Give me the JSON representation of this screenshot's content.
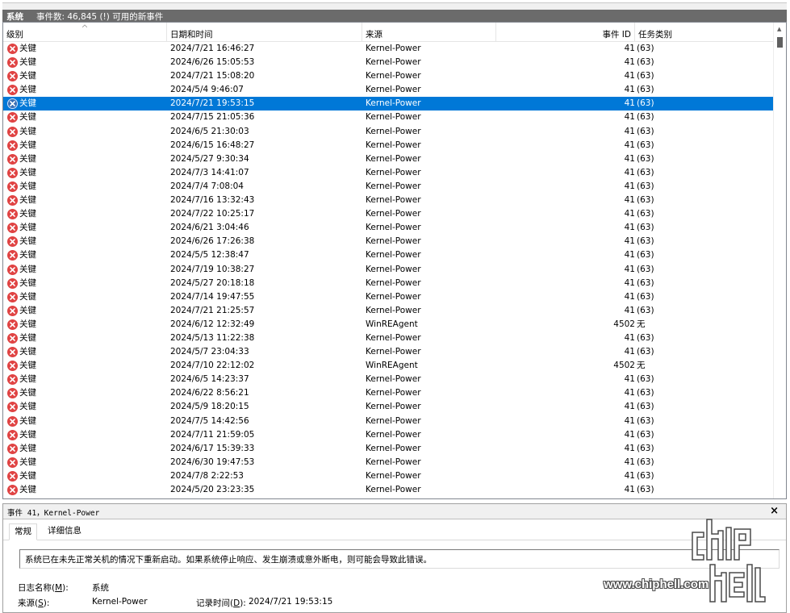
{
  "titlebar": {
    "log_name": "系统",
    "event_count_text": "事件数: 46,845 (!) 可用的新事件"
  },
  "columns": {
    "level": "级别",
    "date": "日期和时间",
    "source": "来源",
    "event_id": "事件 ID",
    "task": "任务类别"
  },
  "events": [
    {
      "level": "关键",
      "date": "2024/7/21 16:46:27",
      "source": "Kernel-Power",
      "id": "41",
      "task": "(63)"
    },
    {
      "level": "关键",
      "date": "2024/6/26 15:05:53",
      "source": "Kernel-Power",
      "id": "41",
      "task": "(63)"
    },
    {
      "level": "关键",
      "date": "2024/7/21 15:08:20",
      "source": "Kernel-Power",
      "id": "41",
      "task": "(63)"
    },
    {
      "level": "关键",
      "date": "2024/5/4 9:46:07",
      "source": "Kernel-Power",
      "id": "41",
      "task": "(63)"
    },
    {
      "level": "关键",
      "date": "2024/7/21 19:53:15",
      "source": "Kernel-Power",
      "id": "41",
      "task": "(63)",
      "selected": true
    },
    {
      "level": "关键",
      "date": "2024/7/15 21:05:36",
      "source": "Kernel-Power",
      "id": "41",
      "task": "(63)"
    },
    {
      "level": "关键",
      "date": "2024/6/5 21:30:03",
      "source": "Kernel-Power",
      "id": "41",
      "task": "(63)"
    },
    {
      "level": "关键",
      "date": "2024/6/15 16:48:27",
      "source": "Kernel-Power",
      "id": "41",
      "task": "(63)"
    },
    {
      "level": "关键",
      "date": "2024/5/27 9:30:34",
      "source": "Kernel-Power",
      "id": "41",
      "task": "(63)"
    },
    {
      "level": "关键",
      "date": "2024/7/3 14:41:07",
      "source": "Kernel-Power",
      "id": "41",
      "task": "(63)"
    },
    {
      "level": "关键",
      "date": "2024/7/4 7:08:04",
      "source": "Kernel-Power",
      "id": "41",
      "task": "(63)"
    },
    {
      "level": "关键",
      "date": "2024/7/16 13:32:43",
      "source": "Kernel-Power",
      "id": "41",
      "task": "(63)"
    },
    {
      "level": "关键",
      "date": "2024/7/22 10:25:17",
      "source": "Kernel-Power",
      "id": "41",
      "task": "(63)"
    },
    {
      "level": "关键",
      "date": "2024/6/21 3:04:46",
      "source": "Kernel-Power",
      "id": "41",
      "task": "(63)"
    },
    {
      "level": "关键",
      "date": "2024/6/26 17:26:38",
      "source": "Kernel-Power",
      "id": "41",
      "task": "(63)"
    },
    {
      "level": "关键",
      "date": "2024/5/5 12:38:47",
      "source": "Kernel-Power",
      "id": "41",
      "task": "(63)"
    },
    {
      "level": "关键",
      "date": "2024/7/19 10:38:27",
      "source": "Kernel-Power",
      "id": "41",
      "task": "(63)"
    },
    {
      "level": "关键",
      "date": "2024/5/27 20:18:18",
      "source": "Kernel-Power",
      "id": "41",
      "task": "(63)"
    },
    {
      "level": "关键",
      "date": "2024/7/14 19:47:55",
      "source": "Kernel-Power",
      "id": "41",
      "task": "(63)"
    },
    {
      "level": "关键",
      "date": "2024/7/21 21:25:57",
      "source": "Kernel-Power",
      "id": "41",
      "task": "(63)"
    },
    {
      "level": "关键",
      "date": "2024/6/12 12:32:49",
      "source": "WinREAgent",
      "id": "4502",
      "task": "无"
    },
    {
      "level": "关键",
      "date": "2024/5/13 11:22:38",
      "source": "Kernel-Power",
      "id": "41",
      "task": "(63)"
    },
    {
      "level": "关键",
      "date": "2024/5/7 23:04:33",
      "source": "Kernel-Power",
      "id": "41",
      "task": "(63)"
    },
    {
      "level": "关键",
      "date": "2024/7/10 22:12:02",
      "source": "WinREAgent",
      "id": "4502",
      "task": "无"
    },
    {
      "level": "关键",
      "date": "2024/6/5 14:23:37",
      "source": "Kernel-Power",
      "id": "41",
      "task": "(63)"
    },
    {
      "level": "关键",
      "date": "2024/6/22 8:56:21",
      "source": "Kernel-Power",
      "id": "41",
      "task": "(63)"
    },
    {
      "level": "关键",
      "date": "2024/5/9 18:20:15",
      "source": "Kernel-Power",
      "id": "41",
      "task": "(63)"
    },
    {
      "level": "关键",
      "date": "2024/7/5 14:42:56",
      "source": "Kernel-Power",
      "id": "41",
      "task": "(63)"
    },
    {
      "level": "关键",
      "date": "2024/7/11 21:59:05",
      "source": "Kernel-Power",
      "id": "41",
      "task": "(63)"
    },
    {
      "level": "关键",
      "date": "2024/6/17 15:39:33",
      "source": "Kernel-Power",
      "id": "41",
      "task": "(63)"
    },
    {
      "level": "关键",
      "date": "2024/6/30 19:47:53",
      "source": "Kernel-Power",
      "id": "41",
      "task": "(63)"
    },
    {
      "level": "关键",
      "date": "2024/7/8 2:22:53",
      "source": "Kernel-Power",
      "id": "41",
      "task": "(63)"
    },
    {
      "level": "关键",
      "date": "2024/5/20 23:23:35",
      "source": "Kernel-Power",
      "id": "41",
      "task": "(63)"
    }
  ],
  "detail": {
    "title": "事件 41，Kernel-Power",
    "close": "×",
    "tab_general": "常规",
    "tab_details": "详细信息",
    "message": "系统已在未先正常关机的情况下重新启动。如果系统停止响应、发生崩溃或意外断电，则可能会导致此错误。",
    "log_name_label_pre": "日志名称(",
    "log_name_label_key": "M",
    "log_name_label_post": "):",
    "log_name_value": "系统",
    "source_label_pre": "来源(",
    "source_label_key": "S",
    "source_label_post": "):",
    "source_value": "Kernel-Power",
    "logged_label_pre": "记录时间(",
    "logged_label_key": "D",
    "logged_label_post": "):",
    "logged_value": "2024/7/21 19:53:15"
  },
  "watermark": {
    "url_text": "www.chiphell.com",
    "logo_text": "chip hell"
  },
  "colors": {
    "selection": "#0078d7",
    "error_icon": "#e04343",
    "title_band": "#6b6b6b"
  },
  "icons": {
    "level": "critical-error-icon",
    "sort": "sort-arrow-icon",
    "close": "close-icon"
  }
}
